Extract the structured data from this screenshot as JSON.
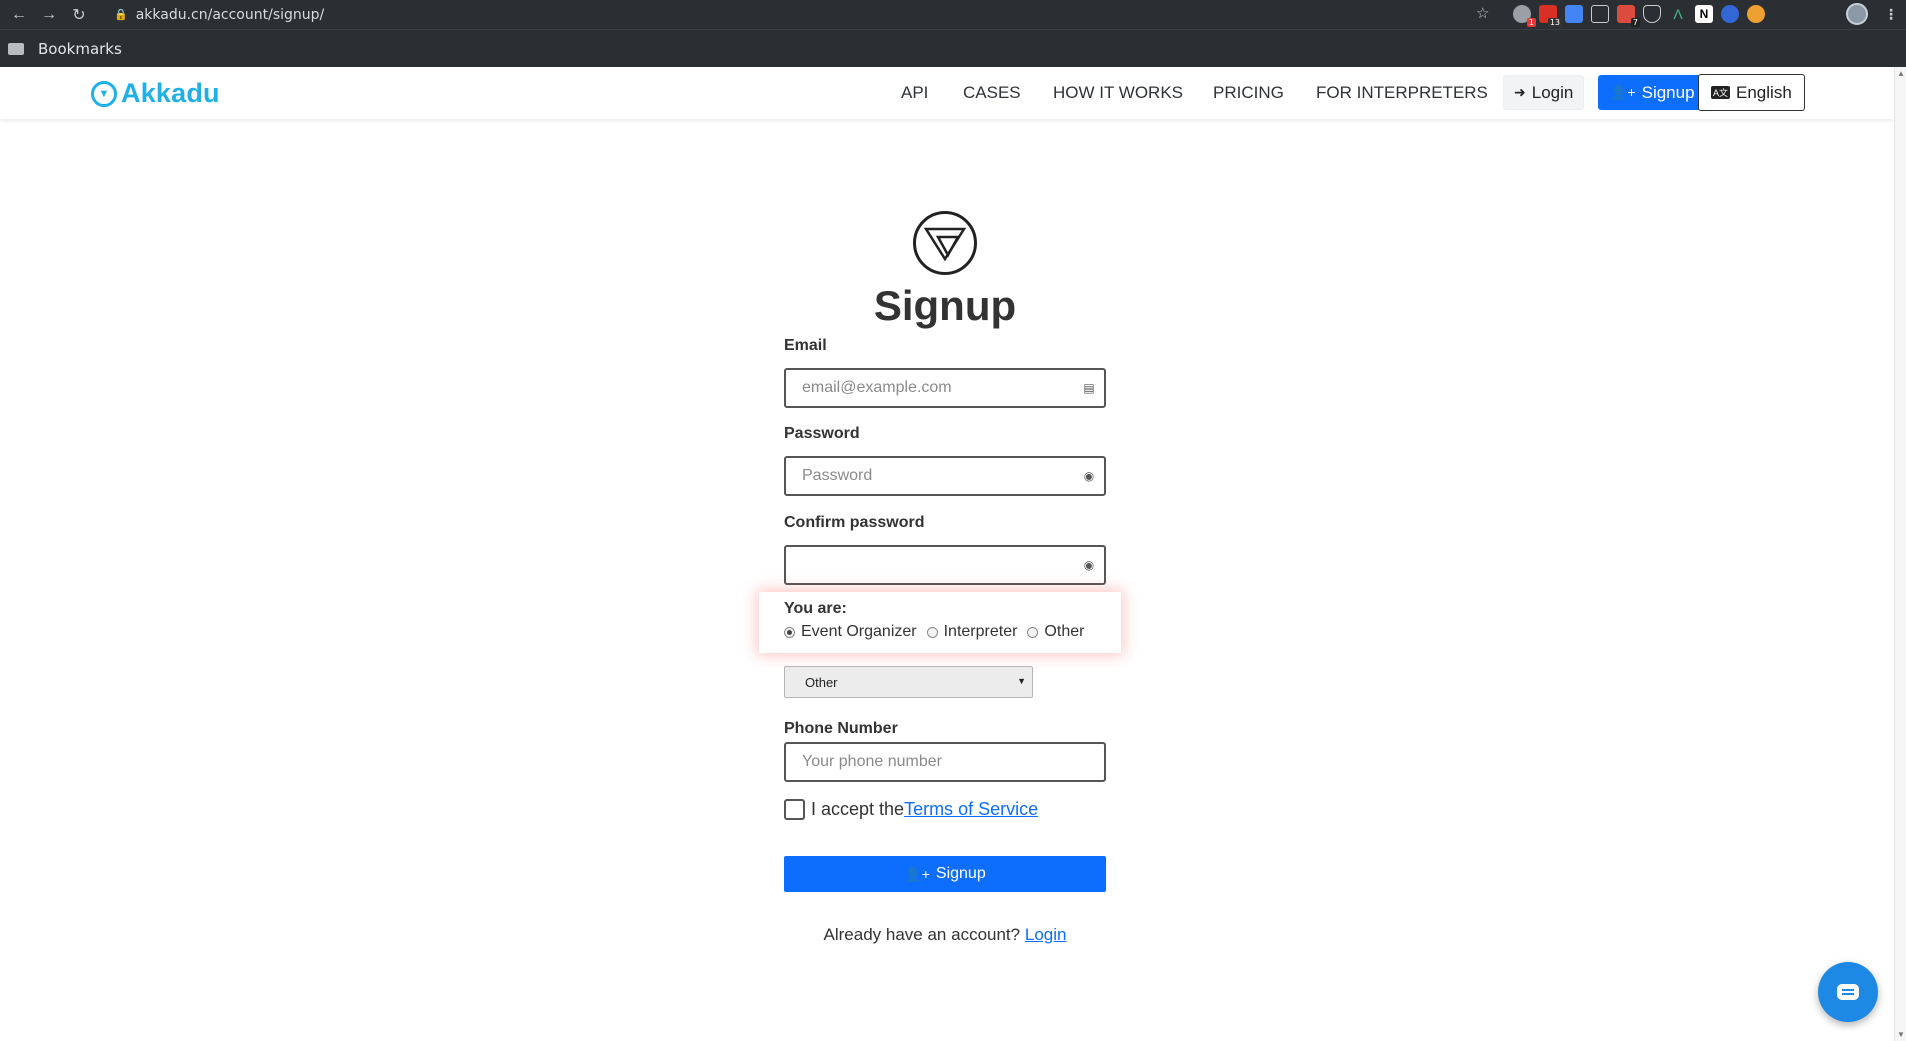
{
  "browser": {
    "url": "akkadu.cn/account/signup/",
    "bookmarks_label": "Bookmarks",
    "ext_badges": [
      "1",
      "13",
      "7"
    ]
  },
  "header": {
    "brand_name": "Akkadu",
    "nav": [
      "API",
      "CASES",
      "HOW IT WORKS",
      "PRICING",
      "FOR INTERPRETERS"
    ],
    "login_label": "Login",
    "signup_label": "Signup",
    "language_label": "English",
    "brand_color": "#1fb0e8",
    "primary_color": "#0d6efd"
  },
  "form": {
    "title": "Signup",
    "email_label": "Email",
    "email_placeholder": "email@example.com",
    "password_label": "Password",
    "password_placeholder": "Password",
    "confirm_label": "Confirm password",
    "confirm_placeholder": "",
    "you_are_label": "You are:",
    "roles": [
      {
        "label": "Event Organizer",
        "checked": true
      },
      {
        "label": "Interpreter",
        "checked": false
      },
      {
        "label": "Other",
        "checked": false
      }
    ],
    "select_value": "Other",
    "phone_label": "Phone Number",
    "phone_placeholder": "Your phone number",
    "terms_prefix": "I accept the",
    "terms_link": "Terms of Service",
    "submit_label": "Signup",
    "already_text": "Already have an account?",
    "already_link": "Login"
  }
}
